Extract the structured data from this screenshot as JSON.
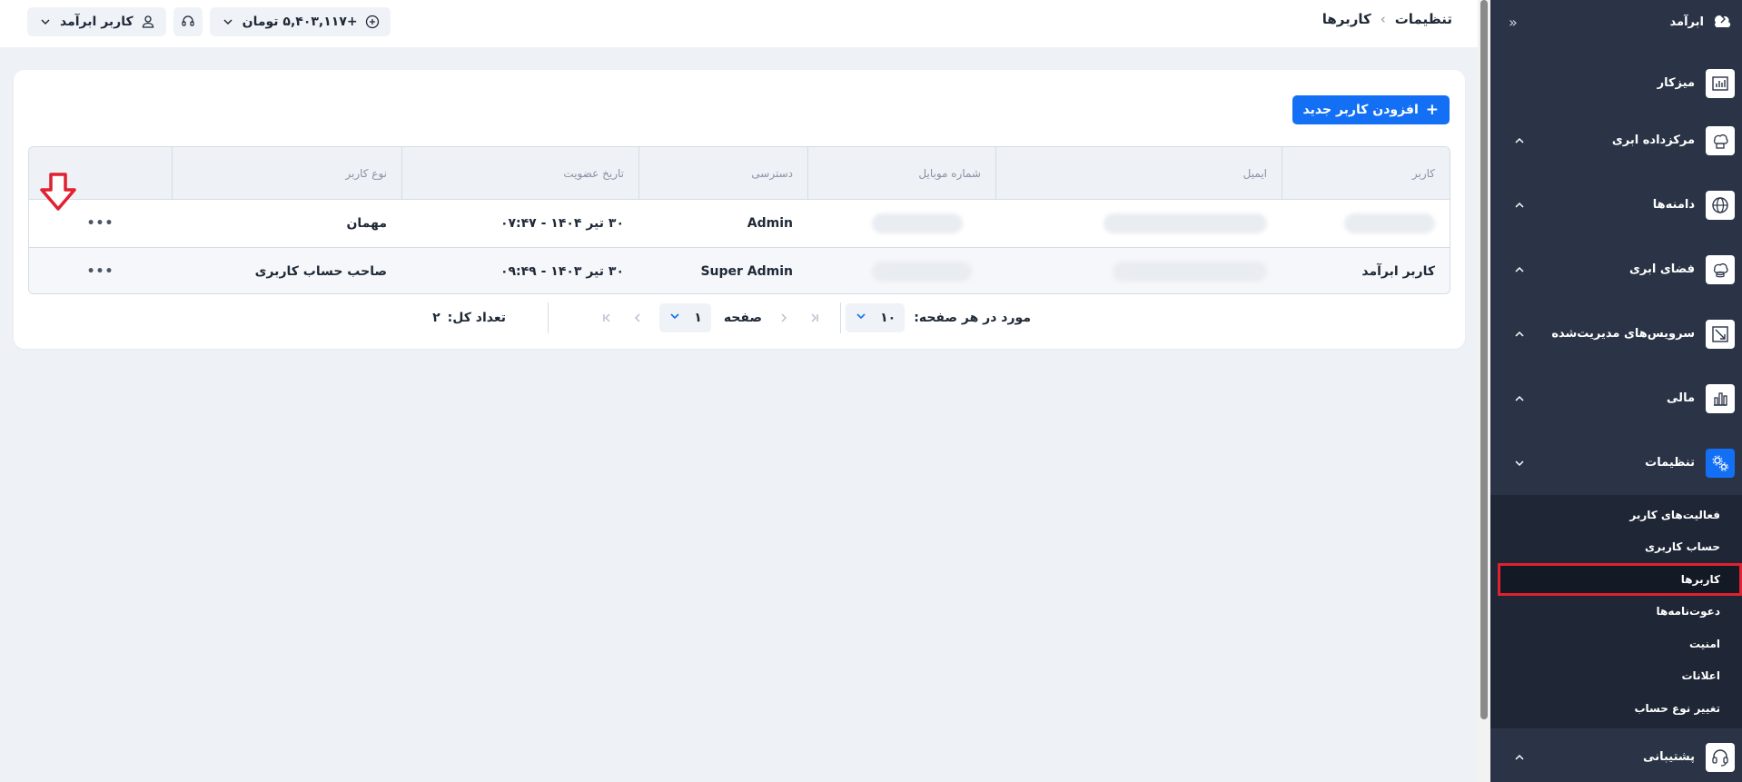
{
  "topbar": {
    "breadcrumb": [
      "تنظیمات",
      "کاربرها"
    ],
    "user_name": "کاربر ابرآمد",
    "balance": "+۵,۴۰۳,۱۱۷ تومان"
  },
  "sidebar": {
    "brand": "ابرآمد",
    "items": [
      {
        "label": "میزکار",
        "icon": "dashboard-icon"
      },
      {
        "label": "مرکزداده ابری",
        "icon": "datacenter-icon"
      },
      {
        "label": "دامنه‌ها",
        "icon": "globe-icon"
      },
      {
        "label": "فضای ابری",
        "icon": "cloud-storage-icon"
      },
      {
        "label": "سرویس‌های مدیریت‌شده",
        "icon": "managed-services-icon"
      },
      {
        "label": "مالی",
        "icon": "finance-chart-icon"
      },
      {
        "label": "تنظیمات",
        "icon": "settings-gears-icon"
      },
      {
        "label": "پشتیبانی",
        "icon": "headset-icon"
      }
    ],
    "settings_sub": [
      "فعالیت‌های کاربر",
      "حساب کاربری",
      "کاربرها",
      "دعوت‌نامه‌ها",
      "امنیت",
      "اعلانات",
      "تغییر نوع حساب"
    ]
  },
  "page": {
    "add_button": "افزودن کاربر جدید"
  },
  "table": {
    "headers": [
      "کاربر",
      "ایمیل",
      "شماره موبایل",
      "دسترسی",
      "تاریخ عضویت",
      "نوع کاربر"
    ],
    "rows": [
      {
        "user": "",
        "access": "Admin",
        "joined": "۳۰ تیر ۱۴۰۴ - ۰۷:۴۷",
        "type": "مهمان"
      },
      {
        "user": "کاربر ابرآمد",
        "access": "Super Admin",
        "joined": "۳۰ تیر ۱۴۰۳ - ۰۹:۴۹",
        "type": "صاحب حساب کاربری"
      }
    ]
  },
  "pagination": {
    "per_page_label": "مورد در هر صفحه:",
    "per_page_value": "۱۰",
    "page_label": "صفحه",
    "page_value": "۱",
    "total_label": "تعداد کل:",
    "total_value": "۲"
  },
  "colors": {
    "primary": "#1370f5",
    "sidebar_bg": "#2b3446",
    "highlight": "#e0212f"
  }
}
